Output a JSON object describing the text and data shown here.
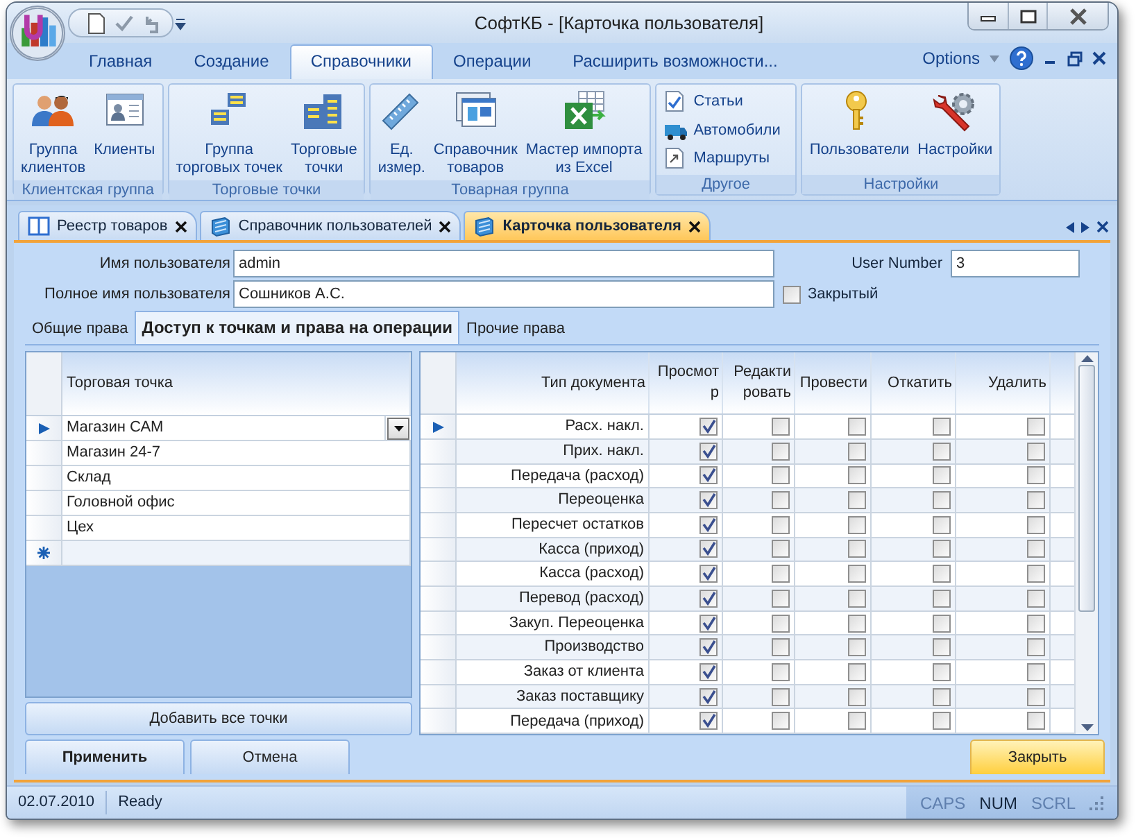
{
  "window": {
    "title": "СофтКБ - [Карточка пользователя]"
  },
  "ribbon_tabs": [
    {
      "label": "Главная",
      "selected": false
    },
    {
      "label": "Создание",
      "selected": false
    },
    {
      "label": "Справочники",
      "selected": true
    },
    {
      "label": "Операции",
      "selected": false
    },
    {
      "label": "Расширить возможности...",
      "selected": false
    }
  ],
  "options_label": "Options",
  "ribbon_groups": [
    {
      "label": "Клиентская группа",
      "items": [
        {
          "kind": "large",
          "lines": [
            "Группа",
            "клиентов"
          ]
        },
        {
          "kind": "large",
          "lines": [
            "Клиенты"
          ]
        }
      ]
    },
    {
      "label": "Торговые точки",
      "items": [
        {
          "kind": "large",
          "lines": [
            "Группа",
            "торговых точек"
          ]
        },
        {
          "kind": "large",
          "lines": [
            "Торговые",
            "точки"
          ]
        }
      ]
    },
    {
      "label": "Товарная группа",
      "items": [
        {
          "kind": "large",
          "lines": [
            "Ед.",
            "измер."
          ]
        },
        {
          "kind": "large",
          "lines": [
            "Справочник",
            "товаров"
          ]
        },
        {
          "kind": "large",
          "lines": [
            "Мастер импорта",
            "из Excel"
          ]
        }
      ]
    },
    {
      "label": "Другое",
      "items": [
        {
          "kind": "small",
          "lines": [
            "Статьи"
          ]
        },
        {
          "kind": "small",
          "lines": [
            "Автомобили"
          ]
        },
        {
          "kind": "small",
          "lines": [
            "Маршруты"
          ]
        }
      ]
    },
    {
      "label": "Настройки",
      "items": [
        {
          "kind": "large",
          "lines": [
            "Пользователи"
          ]
        },
        {
          "kind": "large",
          "lines": [
            "Настройки"
          ]
        }
      ]
    }
  ],
  "doc_tabs": [
    {
      "label": "Реестр товаров",
      "kind": "register",
      "selected": false
    },
    {
      "label": "Справочник пользователей",
      "kind": "reference",
      "selected": false
    },
    {
      "label": "Карточка пользователя",
      "kind": "reference",
      "selected": true
    }
  ],
  "form": {
    "username_label": "Имя пользователя",
    "username": "admin",
    "user_number_label": "User Number",
    "user_number": "3",
    "full_name_label": "Полное имя пользователя",
    "full_name": "Сошников А.С.",
    "closed_label": "Закрытый",
    "closed": false
  },
  "inner_tabs": [
    {
      "label": "Общие права",
      "selected": false
    },
    {
      "label": "Доступ к точкам и права на операции",
      "selected": true
    },
    {
      "label": "Прочие права",
      "selected": false
    }
  ],
  "points_grid": {
    "column": "Торговая точка",
    "new_row": true,
    "rows": [
      {
        "name": "Магазин САМ",
        "selected": true
      },
      {
        "name": "Магазин 24-7",
        "selected": false
      },
      {
        "name": "Склад",
        "selected": false
      },
      {
        "name": "Головной офис",
        "selected": false
      },
      {
        "name": "Цех",
        "selected": false
      }
    ]
  },
  "add_all_button": "Добавить все точки",
  "ops_grid": {
    "columns": [
      "Тип документа",
      "Просмотр",
      "Редактировать",
      "Провести",
      "Откатить",
      "Удалить"
    ],
    "rows": [
      {
        "name": "Расх. накл.",
        "selected": true,
        "perms": [
          true,
          false,
          false,
          false,
          false
        ]
      },
      {
        "name": "Прих. накл.",
        "selected": false,
        "perms": [
          true,
          false,
          false,
          false,
          false
        ]
      },
      {
        "name": "Передача (расход)",
        "selected": false,
        "perms": [
          true,
          false,
          false,
          false,
          false
        ]
      },
      {
        "name": "Переоценка",
        "selected": false,
        "perms": [
          true,
          false,
          false,
          false,
          false
        ]
      },
      {
        "name": "Пересчет остатков",
        "selected": false,
        "perms": [
          true,
          false,
          false,
          false,
          false
        ]
      },
      {
        "name": "Касса (приход)",
        "selected": false,
        "perms": [
          true,
          false,
          false,
          false,
          false
        ]
      },
      {
        "name": "Касса (расход)",
        "selected": false,
        "perms": [
          true,
          false,
          false,
          false,
          false
        ]
      },
      {
        "name": "Перевод (расход)",
        "selected": false,
        "perms": [
          true,
          false,
          false,
          false,
          false
        ]
      },
      {
        "name": "Закуп. Переоценка",
        "selected": false,
        "perms": [
          true,
          false,
          false,
          false,
          false
        ]
      },
      {
        "name": "Производство",
        "selected": false,
        "perms": [
          true,
          false,
          false,
          false,
          false
        ]
      },
      {
        "name": "Заказ от клиента",
        "selected": false,
        "perms": [
          true,
          false,
          false,
          false,
          false
        ]
      },
      {
        "name": "Заказ поставщику",
        "selected": false,
        "perms": [
          true,
          false,
          false,
          false,
          false
        ]
      },
      {
        "name": "Передача (приход)",
        "selected": false,
        "perms": [
          true,
          false,
          false,
          false,
          false
        ]
      }
    ]
  },
  "apply_button": "Применить",
  "cancel_button": "Отмена",
  "close_button": "Закрыть",
  "status_bar": {
    "date": "02.07.2010",
    "message": "Ready",
    "indicators": [
      {
        "label": "CAPS",
        "on": false
      },
      {
        "label": "NUM",
        "on": true
      },
      {
        "label": "SCRL",
        "on": false
      }
    ]
  }
}
